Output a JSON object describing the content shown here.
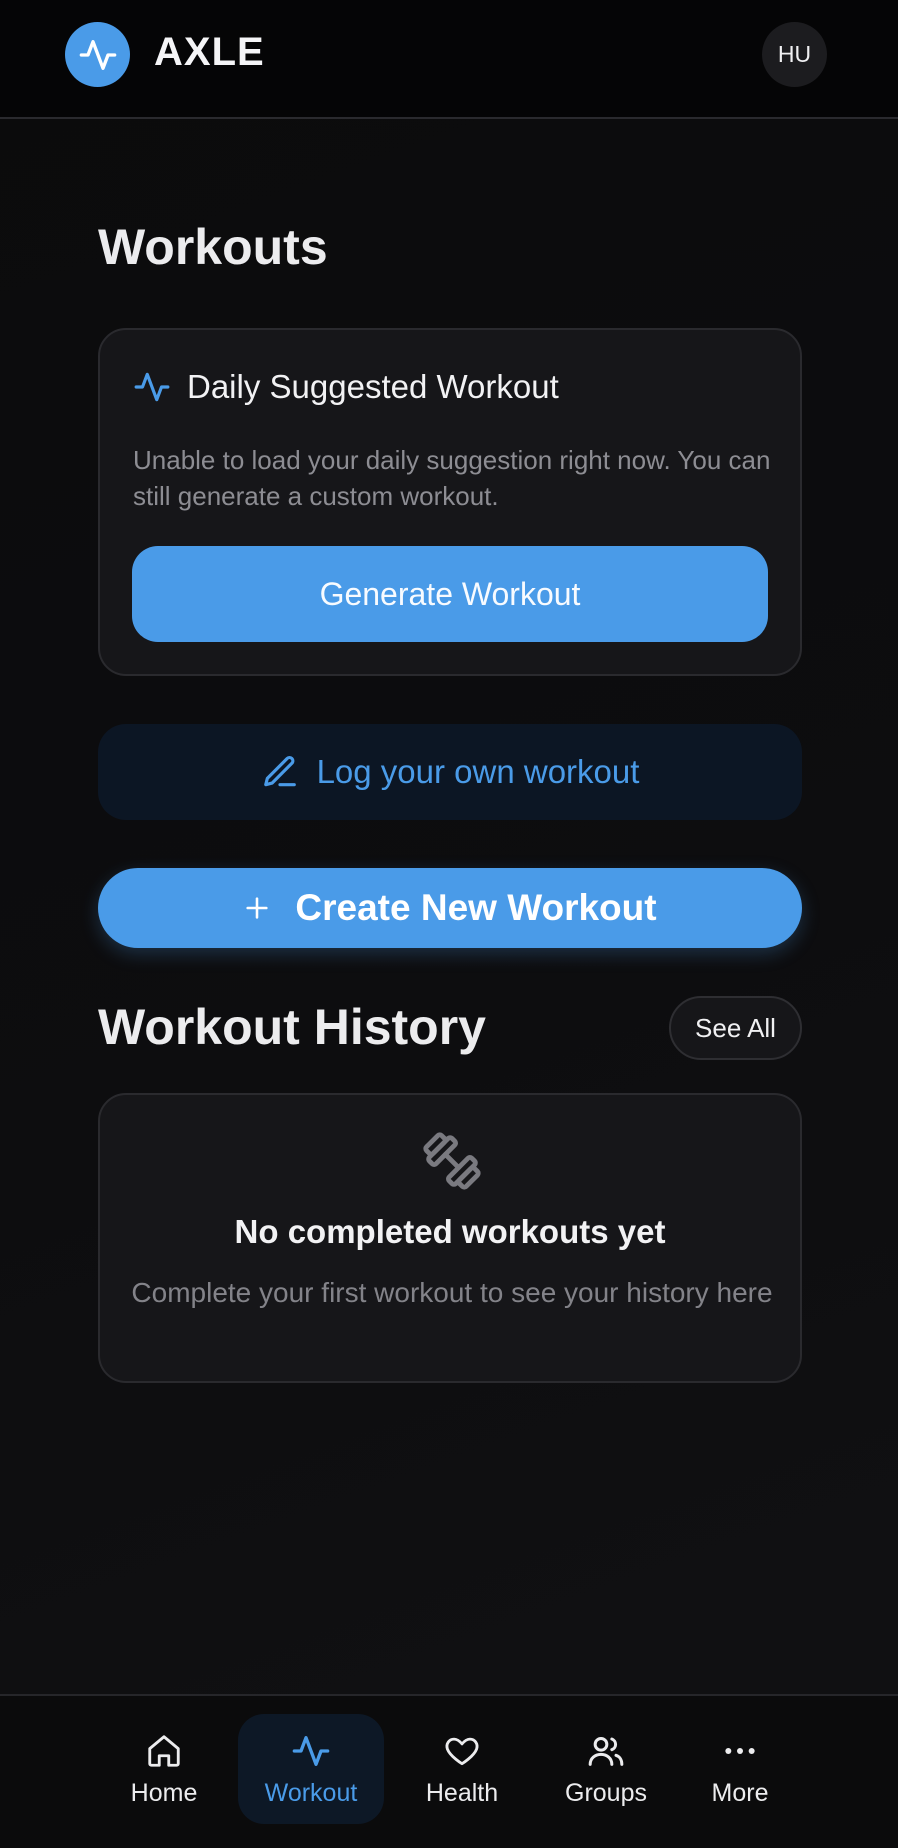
{
  "header": {
    "app_title": "AXLE",
    "logo_icon": "activity-pulse-icon",
    "avatar_initials": "HU"
  },
  "main": {
    "page_title": "Workouts",
    "suggested": {
      "title": "Daily Suggested Workout",
      "message": "Unable to load your daily suggestion right now. You can still generate a custom workout.",
      "generate_label": "Generate Workout"
    },
    "log_label": "Log your own workout",
    "create_label": "Create New Workout",
    "history": {
      "title": "Workout History",
      "see_all_label": "See All",
      "empty_title": "No completed workouts yet",
      "empty_message": "Complete your first workout to see your history here"
    }
  },
  "nav": {
    "items": [
      {
        "label": "Home",
        "icon": "home-icon"
      },
      {
        "label": "Workout",
        "icon": "activity-pulse-icon",
        "active": true
      },
      {
        "label": "Health",
        "icon": "heart-icon"
      },
      {
        "label": "Groups",
        "icon": "users-icon"
      },
      {
        "label": "More",
        "icon": "more-dots-icon"
      }
    ]
  },
  "colors": {
    "accent": "#4a9be8",
    "background": "#0b0b0c",
    "card": "#161619",
    "muted_text": "#8d8d93"
  }
}
